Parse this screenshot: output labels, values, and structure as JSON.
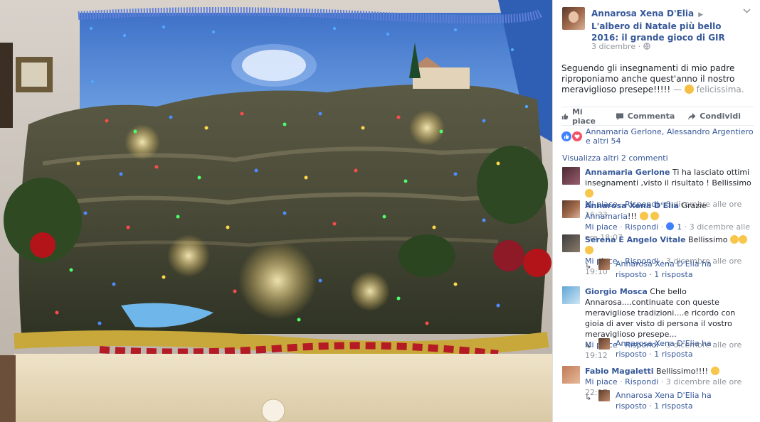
{
  "post": {
    "author": "Annarosa Xena D'Elia",
    "group": "L'albero di Natale più bello 2016: il grande gioco di GIR",
    "date": "3 dicembre",
    "privacy_icon": "globe-icon",
    "text": "Seguendo gli insegnamenti di mio padre riproponiamo anche quest'anno il nostro meraviglioso presepe!!!!!",
    "feeling_prefix": " — ",
    "feeling": "felicissima."
  },
  "actions": {
    "like": "Mi piace",
    "comment": "Commenta",
    "share": "Condividi"
  },
  "reactions": {
    "text": "Annamaria Gerlone, Alessandro Argentiero e altri 54"
  },
  "comments_more": "Visualizza altri 2 commenti",
  "comments": [
    {
      "name": "Annamaria Gerlone",
      "text": " Ti ha lasciato ottimi insegnamenti ,visto il risultato ! Bellissimo ",
      "like": "Mi piace",
      "reply": "Rispondi",
      "time": "3 dicembre alle ore 16:33"
    },
    {
      "name": "Annarosa Xena D'Elia",
      "text": " Grazie ",
      "mention": "Annamaria",
      "text2": "!!! ",
      "like": "Mi piace",
      "reply": "Rispondi",
      "like_count": "1",
      "time": "3 dicembre alle ore 18:07"
    },
    {
      "name": "Serena E Angelo Vitale",
      "text": " Bellissimo ",
      "like": "Mi piace",
      "reply": "Rispondi",
      "time": "3 dicembre alle ore 19:10",
      "reply_line": "Annarosa Xena D'Elia ha risposto · 1 risposta"
    },
    {
      "name": "Giorgio Mosca",
      "text": " Che bello Annarosa....continuate con queste meravigliose tradizioni....e ricordo con gioia di aver visto di persona il vostro meraviglioso presepe...",
      "like": "Mi piace",
      "reply": "Rispondi",
      "time": "3 dicembre alle ore 19:12",
      "reply_line": "Annarosa Xena D'Elia ha risposto · 1 risposta"
    },
    {
      "name": "Fabio Magaletti",
      "text": " Bellissimo!!!! ",
      "like": "Mi piace",
      "reply": "Rispondi",
      "time": "3 dicembre alle ore 22:17",
      "reply_line": "Annarosa Xena D'Elia ha risposto · 1 risposta"
    }
  ],
  "colors": {
    "link": "#365899",
    "muted": "#90949c",
    "like_blue": "#4080ff",
    "love_red": "#f25268"
  }
}
